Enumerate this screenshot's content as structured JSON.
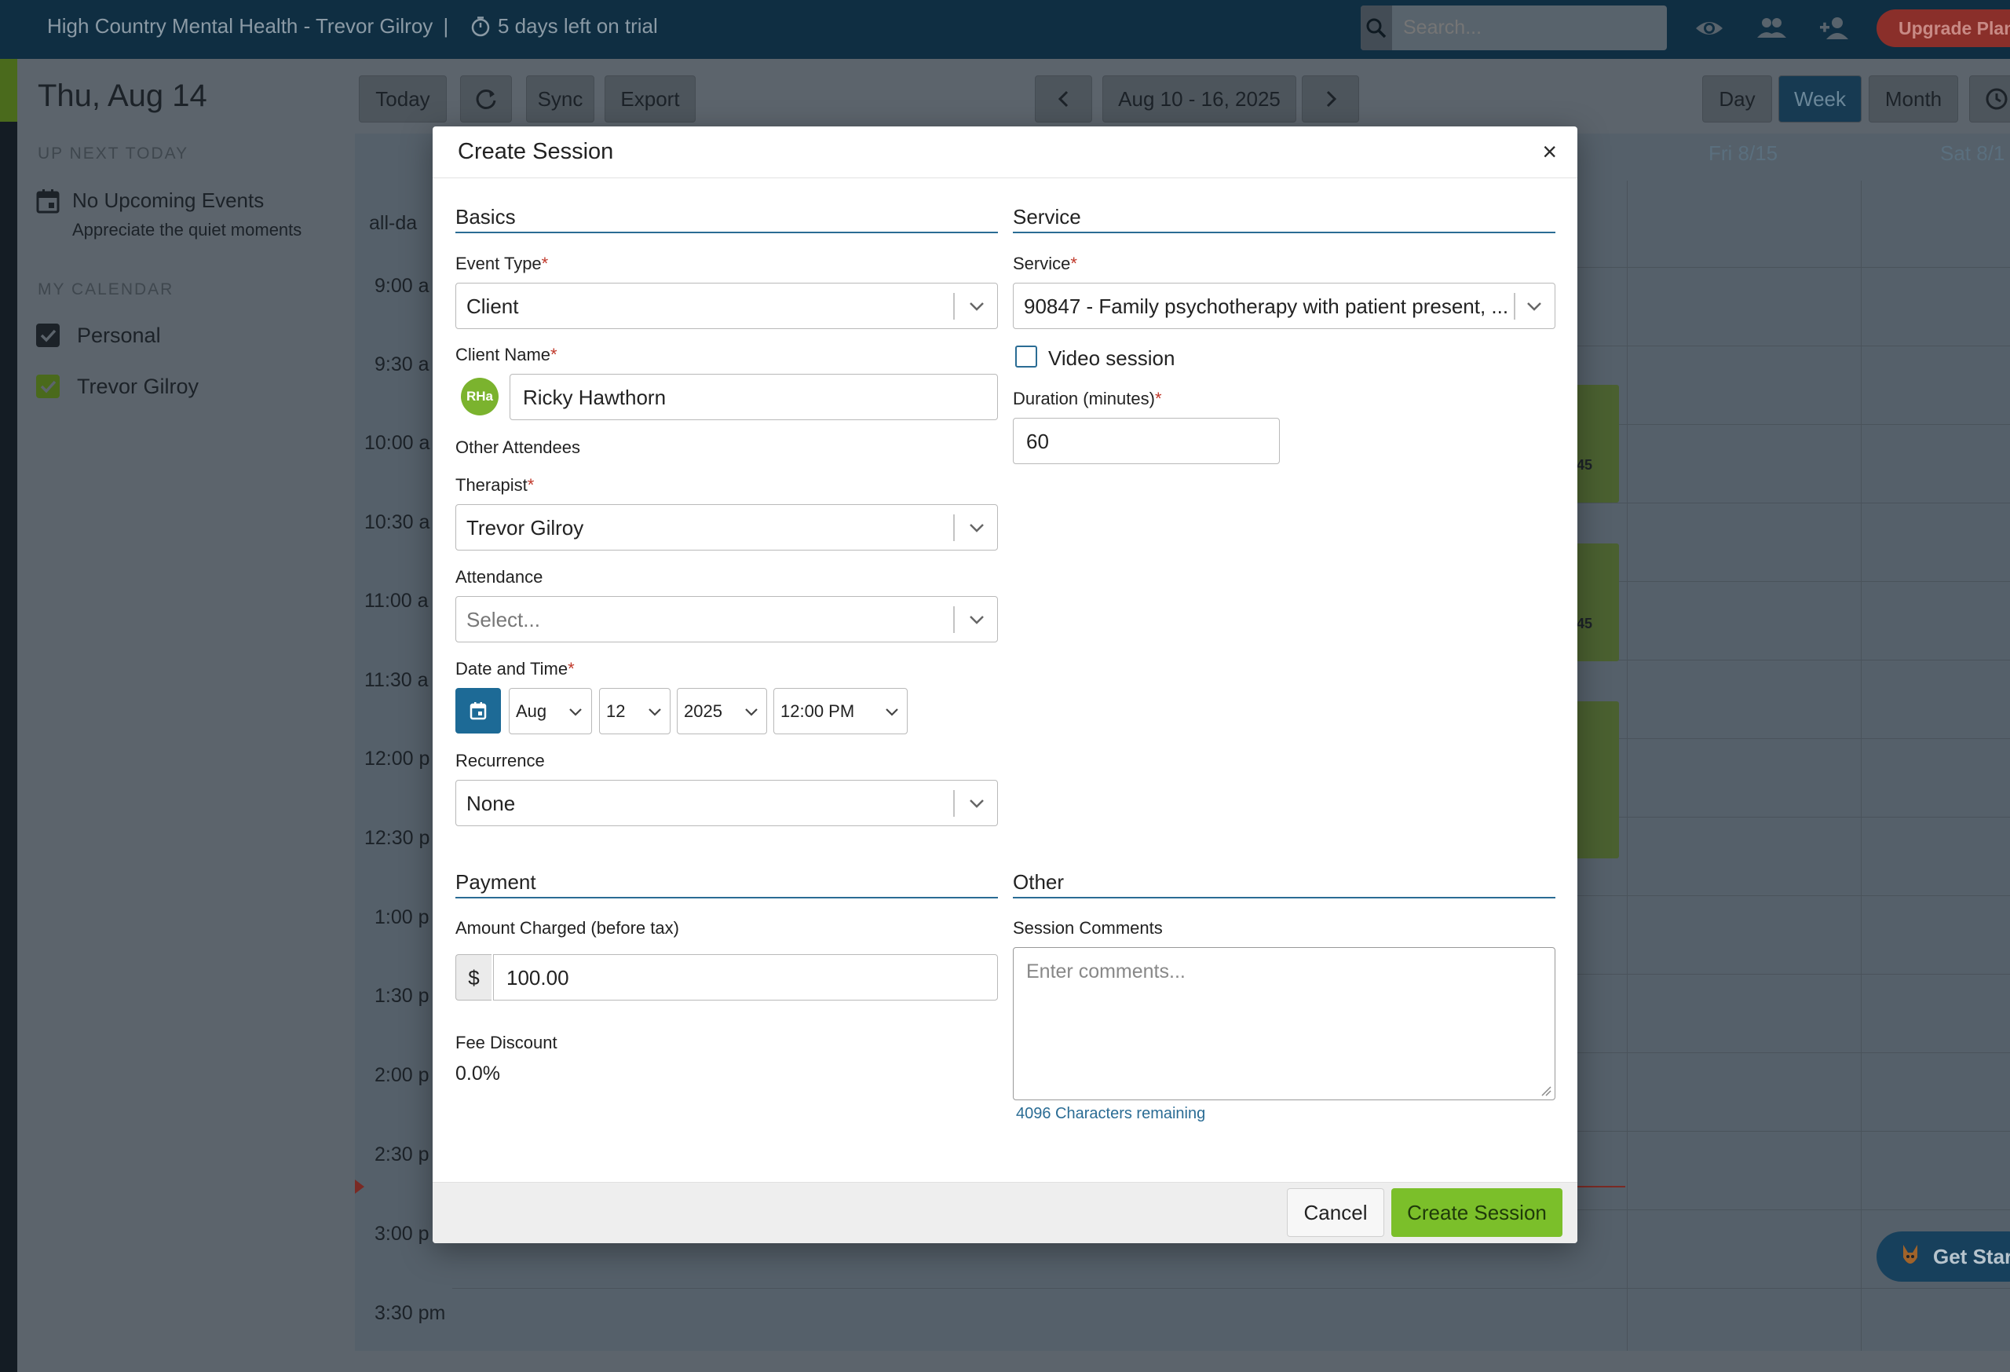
{
  "topbar": {
    "title": "High Country Mental Health - Trevor Gilroy",
    "separator": "|",
    "trial_text": "5 days left on trial",
    "search_placeholder": "Search...",
    "upgrade_label": "Upgrade Plan"
  },
  "sidebar": {
    "date_heading": "Thu, Aug 14",
    "up_next_label": "UP NEXT TODAY",
    "no_events": "No Upcoming Events",
    "quiet_moments": "Appreciate the quiet moments",
    "my_calendar_label": "MY CALENDAR",
    "calendars": [
      {
        "name": "Personal",
        "color": "#1c2228",
        "checked": true
      },
      {
        "name": "Trevor Gilroy",
        "color": "#4a6a1c",
        "checked": true
      }
    ]
  },
  "toolbar": {
    "today": "Today",
    "sync": "Sync",
    "export": "Export",
    "range": "Aug 10 - 16, 2025",
    "views": [
      "Day",
      "Week",
      "Month"
    ],
    "active_view": "Week"
  },
  "calendar": {
    "all_day_label": "all-da",
    "day_headers": [
      "Fri 8/15",
      "Sat 8/1"
    ],
    "times": [
      "9:00 a",
      "9:30 a",
      "10:00 a",
      "10:30 a",
      "11:00 a",
      "11:30 a",
      "12:00 p",
      "12:30 p",
      "1:00 p",
      "1:30 p",
      "2:00 p",
      "2:30 p",
      "3:00 p",
      "3:30 pm"
    ],
    "event_labels": [
      "45",
      "45"
    ]
  },
  "modal": {
    "title": "Create Session",
    "close": "×",
    "basics": {
      "heading": "Basics",
      "event_type_label": "Event Type",
      "event_type_value": "Client",
      "client_name_label": "Client Name",
      "client_initials": "RHa",
      "client_name_value": "Ricky Hawthorn",
      "other_attendees_label": "Other Attendees",
      "therapist_label": "Therapist",
      "therapist_value": "Trevor Gilroy",
      "attendance_label": "Attendance",
      "attendance_placeholder": "Select...",
      "date_time_label": "Date and Time",
      "month": "Aug",
      "day": "12",
      "year": "2025",
      "time": "12:00 PM",
      "recurrence_label": "Recurrence",
      "recurrence_value": "None"
    },
    "service": {
      "heading": "Service",
      "service_label": "Service",
      "service_value": "90847 - Family psychotherapy with patient present, ...",
      "video_session_label": "Video session",
      "video_session_checked": false,
      "duration_label": "Duration (minutes)",
      "duration_value": "60"
    },
    "payment": {
      "heading": "Payment",
      "amount_label": "Amount Charged (before tax)",
      "currency_symbol": "$",
      "amount_value": "100.00",
      "fee_discount_label": "Fee Discount",
      "fee_discount_value": "0.0%"
    },
    "other": {
      "heading": "Other",
      "comments_label": "Session Comments",
      "comments_placeholder": "Enter comments...",
      "chars_remaining": "4096 Characters remaining"
    },
    "required_marker": "*",
    "cancel_label": "Cancel",
    "create_label": "Create Session"
  },
  "widget": {
    "get_started": "Get Star"
  },
  "colors": {
    "brand_blue": "#1d6a96",
    "create_green": "#7bbf2a",
    "required_red": "#c0392b",
    "topbar": "#0f2e42"
  }
}
